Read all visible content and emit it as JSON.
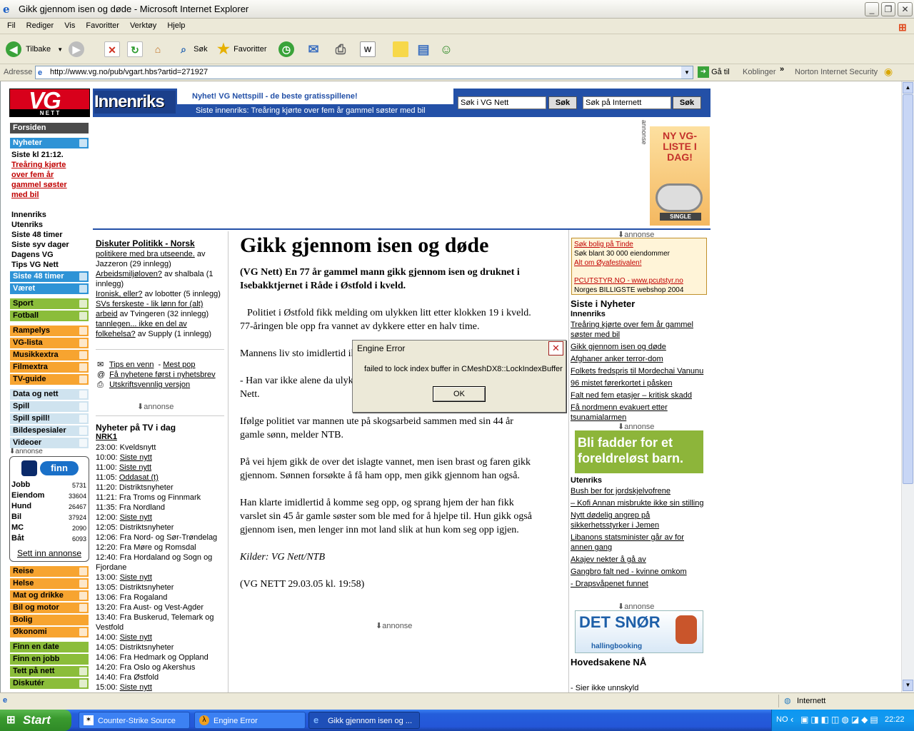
{
  "window": {
    "title": "Gikk gjennom isen og døde - Microsoft Internet Explorer",
    "minimize_icon": "minimize-icon",
    "maximize_icon": "maximize-icon",
    "close_icon": "close-icon"
  },
  "menu": [
    "Fil",
    "Rediger",
    "Vis",
    "Favoritter",
    "Verktøy",
    "Hjelp"
  ],
  "toolbar": {
    "back": "Tilbake",
    "search": "Søk",
    "favorites": "Favoritter"
  },
  "address": {
    "label": "Adresse",
    "url": "http://www.vg.no/pub/vgart.hbs?artid=271927",
    "go": "Gå til",
    "links": "Koblinger",
    "norton": "Norton Internet Security"
  },
  "vg": {
    "logo": "VG",
    "logo_sub": "N E T T",
    "section": "Innenriks",
    "promo": "Nyhet! VG Nettspill - de beste gratisspillene!",
    "ticker": "Siste innenriks: Treåring kjørte over fem år gammel søster med bil",
    "search_vg_placeholder": "Søk i VG Nett",
    "search_vg_btn": "Søk",
    "search_web_placeholder": "Søk på Internett",
    "search_web_btn": "Søk",
    "ad_label": "annonse",
    "ad_topp20": "NY VG-LISTE I DAG!",
    "ad_topp20_sub": "SINGLE"
  },
  "leftnav": {
    "forsiden": "Forsiden",
    "nyheter": "Nyheter",
    "siste_time": "Siste kl 21:12.",
    "siste_headline": "Treåring kjørte over fem år gammel søster med bil",
    "links": [
      "Innenriks",
      "Utenriks",
      "Siste 48 timer",
      "Siste syv dager",
      "Dagens VG",
      "Tips VG Nett"
    ],
    "blue_sections": [
      "Siste 48 timer",
      "Været"
    ],
    "green_sections": [
      "Sport",
      "Fotball"
    ],
    "orange_sections": [
      "Rampelys",
      "VG-lista",
      "Musikkextra",
      "Filmextra",
      "TV-guide"
    ],
    "lblue_sections": [
      "Data og nett",
      "Spill",
      "Spill spill!",
      "Bildespesialer",
      "Videoer"
    ],
    "ad_label": "annonse",
    "finn": {
      "logo": "finn",
      "rows": [
        {
          "label": "Jobb",
          "count": "5731"
        },
        {
          "label": "Eiendom",
          "count": "33604"
        },
        {
          "label": "Hund",
          "count": "26467"
        },
        {
          "label": "Bil",
          "count": "37924"
        },
        {
          "label": "MC",
          "count": "2090"
        },
        {
          "label": "Båt",
          "count": "6093"
        }
      ],
      "cta": "Sett inn annonse"
    },
    "orange2_sections": [
      "Reise",
      "Helse",
      "Mat og drikke",
      "Bil og motor",
      "Bolig",
      "Økonomi"
    ],
    "green2_sections": [
      "Finn en date",
      "Finn en jobb",
      "Tett på nett",
      "Diskutér"
    ]
  },
  "middlecol": {
    "discuss_title": "Diskuter Politikk - Norsk",
    "discuss_items": [
      {
        "link": "politikere med bra utseende.",
        "meta": " av Jazzeron (29 innlegg)"
      },
      {
        "link": "Arbeidsmiljøloven?",
        "meta": " av shalbala (1 innlegg)"
      },
      {
        "link": "Ironisk, eller?",
        "meta": " av lobotter (5 innlegg)"
      },
      {
        "link": "SVs ferskeste - lik lønn for (alt) arbeid",
        "meta": " av Tvingeren (32 innlegg)"
      },
      {
        "link": "tannlegen... ikke en del av folkehelsa?",
        "meta": " av Supply (1 innlegg)"
      }
    ],
    "tips": "Tips en venn",
    "mest_pop": "Mest pop",
    "newsletter": "Få nyhetene først i nyhetsbrev",
    "print": "Utskriftsvennlig versjon",
    "ad_label": "annonse",
    "tv_title": "Nyheter på TV i dag",
    "tv_channel": "NRK1",
    "tv": [
      {
        "t": "23:00:",
        "p": "Kveldsnytt",
        "link": false
      },
      {
        "t": "10:00:",
        "p": "Siste nytt",
        "link": true
      },
      {
        "t": "11:00:",
        "p": "Siste nytt",
        "link": true
      },
      {
        "t": "11:05:",
        "p": "Oddasat (t)",
        "link": true
      },
      {
        "t": "11:20:",
        "p": "Distriktsnyheter",
        "link": false
      },
      {
        "t": "11:21:",
        "p": "Fra Troms og Finnmark",
        "link": false
      },
      {
        "t": "11:35:",
        "p": "Fra Nordland",
        "link": false
      },
      {
        "t": "12:00:",
        "p": "Siste nytt",
        "link": true
      },
      {
        "t": "12:05:",
        "p": "Distriktsnyheter",
        "link": false
      },
      {
        "t": "12:06:",
        "p": "Fra Nord- og Sør-Trøndelag",
        "link": false
      },
      {
        "t": "12:20:",
        "p": "Fra Møre og Romsdal",
        "link": false
      },
      {
        "t": "12:40:",
        "p": "Fra Hordaland og Sogn og Fjordane",
        "link": false
      },
      {
        "t": "13:00:",
        "p": "Siste nytt",
        "link": true
      },
      {
        "t": "13:05:",
        "p": "Distriktsnyheter",
        "link": false
      },
      {
        "t": "13:06:",
        "p": "Fra Rogaland",
        "link": false
      },
      {
        "t": "13:20:",
        "p": "Fra Aust- og Vest-Agder",
        "link": false
      },
      {
        "t": "13:40:",
        "p": "Fra Buskerud, Telemark og Vestfold",
        "link": false
      },
      {
        "t": "14:00:",
        "p": "Siste nytt",
        "link": true
      },
      {
        "t": "14:05:",
        "p": "Distriktsnyheter",
        "link": false
      },
      {
        "t": "14:06:",
        "p": "Fra Hedmark og Oppland",
        "link": false
      },
      {
        "t": "14:20:",
        "p": "Fra Oslo og Akershus",
        "link": false
      },
      {
        "t": "14:40:",
        "p": "Fra Østfold",
        "link": false
      },
      {
        "t": "15:00:",
        "p": "Siste nytt",
        "link": true
      }
    ]
  },
  "article": {
    "headline": "Gikk gjennom isen og døde",
    "lead": "(VG Nett) En 77 år gammel mann gikk gjennom isen og druknet i Isebakktjernet i Råde i Østfold i kveld.",
    "p1": "Politiet i Østfold fikk melding om ulykken litt etter klokken 19 i kveld. 77-åringen ble opp fra vannet av dykkere etter en halv time.",
    "p2": "Mannens liv sto imidlertid ikke til å redde.",
    "p3": "- Han var ikke alene da ulykken skjedde, sier operasjonsleder Puck til VG Nett.",
    "p4": "Ifølge politiet var mannen ute på skogsarbeid sammen med sin 44 år gamle sønn, melder NTB.",
    "p5": "På vei hjem gikk de over det islagte vannet, men isen brast og faren gikk gjennom. Sønnen forsøkte å få ham opp, men gikk gjennom han også.",
    "p6": "Han klarte imidlertid å komme seg opp, og sprang hjem der han fikk varslet sin 45 år gamle søster som ble med for å hjelpe til. Hun gikk også gjennom isen, men lenger inn mot land slik at hun kom seg opp igjen.",
    "sources": "Kilder: VG Nett/NTB",
    "dateline": "(VG NETT 29.03.05 kl. 19:58)",
    "ad_label": "annonse"
  },
  "rightcol": {
    "ad_label": "annonse",
    "ad_links": [
      "Søk bolig på Tinde",
      "Søk blant 30 000 eiendommer",
      "Alt om Øyafestivalen!",
      "PCUTSTYR.NO - www.pcutstyr.no",
      "Norges BILLIGSTE webshop 2004"
    ],
    "siste_title": "Siste i Nyheter",
    "innenriks": "Innenriks",
    "innenriks_links": [
      "Treåring kjørte over fem år gammel søster med bil",
      "Gikk gjennom isen og døde",
      "Afghaner anker terror-dom",
      "Folkets fredspris til Mordechai Vanunu",
      "96 mistet førerkortet i påsken",
      "Falt ned fem etasjer – kritisk skadd",
      "Få nordmenn evakuert etter tsunamialarmen"
    ],
    "fadder": "Bli fadder for et foreldreløst barn.",
    "utenriks": "Utenriks",
    "utenriks_links": [
      "Bush ber for jordskjelvofrene",
      "– Kofi Annan misbrukte ikke sin stilling",
      "Nytt dødelig angrep på sikkerhetsstyrker i Jemen",
      "Libanons statsminister går av for annen gang",
      "Akajev nekter å gå av",
      "Gangbro falt ned - kvinne omkom",
      "- Drapsvåpenet funnet"
    ],
    "snor": "DET SNØR",
    "snor_brand": "hallingbooking",
    "hoved_title": "Hovedsakene NÅ",
    "hoved_first": "- Sier ikke unnskyld"
  },
  "dialog": {
    "title": "Engine Error",
    "message": "failed to lock index buffer in CMeshDX8::LockIndexBuffer",
    "ok": "OK"
  },
  "status": {
    "zone": "Internett"
  },
  "taskbar": {
    "start": "Start",
    "tasks": [
      "Counter-Strike Source",
      "Engine Error",
      "Gikk gjennom isen og ..."
    ],
    "lang": "NO",
    "clock": "22:22"
  }
}
